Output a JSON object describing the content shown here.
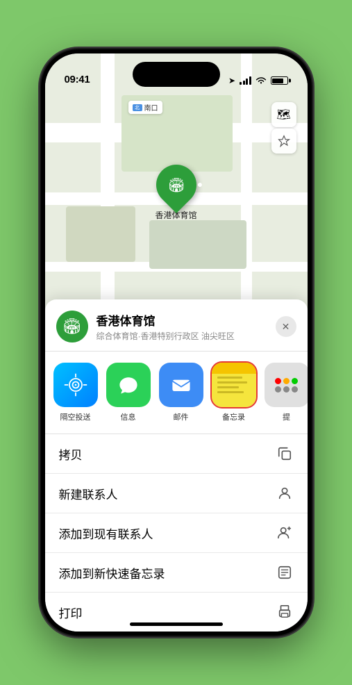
{
  "statusBar": {
    "time": "09:41",
    "locationArrow": "▶"
  },
  "map": {
    "label": "南口",
    "markerName": "香港体育馆",
    "controls": [
      "map",
      "location"
    ]
  },
  "locationCard": {
    "title": "香港体育馆",
    "subtitle": "综合体育馆·香港特别行政区 油尖旺区",
    "closeLabel": "✕"
  },
  "shareItems": [
    {
      "id": "airdrop",
      "label": "隔空投送",
      "type": "airdrop"
    },
    {
      "id": "message",
      "label": "信息",
      "type": "message"
    },
    {
      "id": "mail",
      "label": "邮件",
      "type": "mail"
    },
    {
      "id": "notes",
      "label": "备忘录",
      "type": "notes",
      "highlighted": true
    },
    {
      "id": "more",
      "label": "提",
      "type": "more"
    }
  ],
  "actions": [
    {
      "id": "copy",
      "label": "拷贝",
      "icon": "copy"
    },
    {
      "id": "new-contact",
      "label": "新建联系人",
      "icon": "person"
    },
    {
      "id": "add-contact",
      "label": "添加到现有联系人",
      "icon": "person-add"
    },
    {
      "id": "quick-note",
      "label": "添加到新快速备忘录",
      "icon": "note"
    },
    {
      "id": "print",
      "label": "打印",
      "icon": "print"
    }
  ],
  "colors": {
    "green": "#2d9e3a",
    "red": "#e53935",
    "notes_yellow": "#f5e53d",
    "airdrop_blue": "#0080ff",
    "message_green": "#2bd158",
    "mail_blue": "#3d8cf5"
  }
}
